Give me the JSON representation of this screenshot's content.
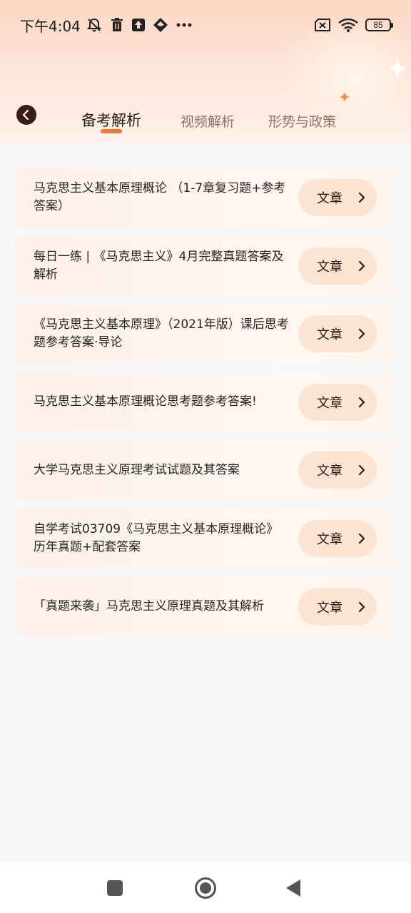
{
  "status_bar": {
    "time": "下午4:04",
    "battery": "85",
    "icons": [
      "notification-off-icon",
      "trash-icon",
      "upload-icon",
      "app-icon",
      "more-dots-icon",
      "sim-x-icon",
      "wifi-icon",
      "battery-icon"
    ]
  },
  "header": {
    "back_icon": "back-arrow-icon",
    "tabs": [
      {
        "label": "备考解析",
        "active": true
      },
      {
        "label": "视频解析",
        "active": false
      },
      {
        "label": "形势与政策",
        "active": false
      }
    ],
    "accent_color": "#f07a3a"
  },
  "articles": [
    {
      "title": "马克思主义基本原理概论 （1-7章复习题+参考答案）",
      "tag": "文章"
    },
    {
      "title": "每日一练 | 《马克思主义》4月完整真题答案及解析",
      "tag": "文章"
    },
    {
      "title": "《马克思主义基本原理》（2021年版）课后思考题参考答案·导论",
      "tag": "文章"
    },
    {
      "title": "马克思主义基本原理概论思考题参考答案!",
      "tag": "文章"
    },
    {
      "title": "大学马克思主义原理考试试题及其答案",
      "tag": "文章"
    },
    {
      "title": "自学考试03709《马克思主义基本原理概论》历年真题+配套答案",
      "tag": "文章"
    },
    {
      "title": "「真题来袭」马克思主义原理真题及其解析",
      "tag": "文章"
    }
  ],
  "nav_bar": {
    "icons": [
      "recent-apps-icon",
      "home-icon",
      "back-icon"
    ]
  }
}
